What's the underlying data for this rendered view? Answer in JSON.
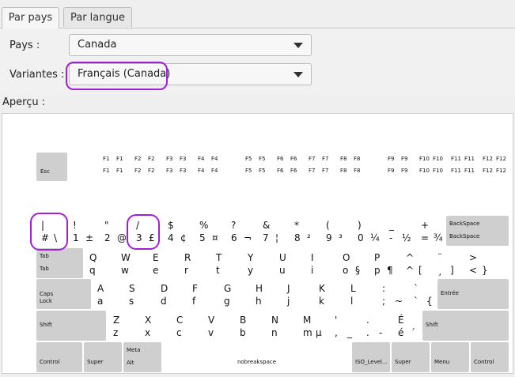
{
  "tabs": [
    {
      "label": "Par pays",
      "active": true
    },
    {
      "label": "Par langue",
      "active": false
    }
  ],
  "country": {
    "label": "Pays :",
    "value": "Canada"
  },
  "variant": {
    "label": "Variantes :",
    "value": "Français (Canada)"
  },
  "preview": {
    "label": "Aperçu :"
  },
  "annotation_color": "#a21fd8",
  "fkeys": {
    "esc": "Esc",
    "groups": [
      [
        "F1",
        "F2",
        "F3",
        "F4"
      ],
      [
        "F5",
        "F6",
        "F7",
        "F8"
      ],
      [
        "F9",
        "F10",
        "F11",
        "F12"
      ]
    ]
  },
  "rows": [
    [
      {
        "tl": "|",
        "bl": "#",
        "br": "\\"
      },
      {
        "tl": "!",
        "bl": "1",
        "br": "±"
      },
      {
        "tl": "\"",
        "bl": "2",
        "br": "@"
      },
      {
        "tl": "/",
        "bl": "3",
        "br": "£"
      },
      {
        "tl": "$",
        "bl": "4",
        "br": "¢"
      },
      {
        "tl": "%",
        "bl": "5",
        "br": "¤"
      },
      {
        "tl": "?",
        "bl": "6",
        "br": "¬"
      },
      {
        "tl": "&",
        "bl": "7",
        "br": "¦"
      },
      {
        "tl": "*",
        "bl": "8",
        "br": "²"
      },
      {
        "tl": "(",
        "bl": "9",
        "br": "³"
      },
      {
        "tl": ")",
        "bl": "0",
        "br": "¼"
      },
      {
        "tl": "_",
        "bl": "-",
        "br": "½"
      },
      {
        "tl": "+",
        "bl": "=",
        "br": "¾"
      },
      {
        "tl": "BackSpace",
        "bl": "BackSpace",
        "br": "",
        "gray": true
      }
    ],
    [
      {
        "tl": "Tab",
        "bl": "Tab",
        "br": "",
        "gray": true
      },
      {
        "tl": "Q",
        "bl": "q",
        "br": ""
      },
      {
        "tl": "W",
        "bl": "w",
        "br": ""
      },
      {
        "tl": "E",
        "bl": "e",
        "br": ""
      },
      {
        "tl": "R",
        "bl": "r",
        "br": ""
      },
      {
        "tl": "T",
        "bl": "t",
        "br": ""
      },
      {
        "tl": "Y",
        "bl": "y",
        "br": ""
      },
      {
        "tl": "U",
        "bl": "u",
        "br": ""
      },
      {
        "tl": "I",
        "bl": "i",
        "br": ""
      },
      {
        "tl": "O",
        "bl": "o",
        "br": "§"
      },
      {
        "tl": "P",
        "bl": "p",
        "br": "¶"
      },
      {
        "tl": "^",
        "bl": "^",
        "br": "["
      },
      {
        "tl": "¨",
        "bl": "¸",
        "br": "]"
      },
      {
        "tl": ">",
        "bl": "<",
        "br": "}"
      }
    ],
    [
      {
        "tl": "Caps\nLock",
        "bl": "",
        "br": "",
        "gray": true
      },
      {
        "tl": "A",
        "bl": "a",
        "br": ""
      },
      {
        "tl": "S",
        "bl": "s",
        "br": ""
      },
      {
        "tl": "D",
        "bl": "d",
        "br": ""
      },
      {
        "tl": "F",
        "bl": "f",
        "br": ""
      },
      {
        "tl": "G",
        "bl": "g",
        "br": ""
      },
      {
        "tl": "H",
        "bl": "h",
        "br": ""
      },
      {
        "tl": "J",
        "bl": "j",
        "br": ""
      },
      {
        "tl": "K",
        "bl": "k",
        "br": ""
      },
      {
        "tl": "L",
        "bl": "l",
        "br": ""
      },
      {
        "tl": ":",
        "bl": ";",
        "br": "~"
      },
      {
        "tl": "`",
        "bl": "`",
        "br": "{"
      },
      {
        "tl": "Entrée",
        "bl": "",
        "br": "",
        "gray": true
      }
    ],
    [
      {
        "tl": "Shift",
        "bl": "",
        "br": "",
        "gray": true
      },
      {
        "tl": "Z",
        "bl": "z",
        "br": ""
      },
      {
        "tl": "X",
        "bl": "x",
        "br": ""
      },
      {
        "tl": "C",
        "bl": "c",
        "br": ""
      },
      {
        "tl": "V",
        "bl": "v",
        "br": ""
      },
      {
        "tl": "B",
        "bl": "b",
        "br": ""
      },
      {
        "tl": "N",
        "bl": "n",
        "br": ""
      },
      {
        "tl": "M",
        "bl": "m",
        "br": "µ"
      },
      {
        "tl": "'",
        "bl": ",",
        "br": "_"
      },
      {
        "tl": ".",
        "bl": ".",
        "br": "-"
      },
      {
        "tl": "É",
        "bl": "é",
        "br": "´"
      },
      {
        "tl": "Shift",
        "bl": "",
        "br": "",
        "gray": true
      }
    ],
    [
      {
        "tl": "Control",
        "bl": "",
        "br": "",
        "gray": true
      },
      {
        "tl": "Super",
        "bl": "",
        "br": "",
        "gray": true
      },
      {
        "tl": "Meta",
        "bl": "Alt",
        "br": "",
        "gray": true
      },
      {
        "tl": "nobreakspace",
        "bl": "",
        "br": ""
      },
      {
        "tl": "ISO_Level...",
        "bl": "",
        "br": "",
        "gray": true
      },
      {
        "tl": "Super",
        "bl": "",
        "br": "",
        "gray": true
      },
      {
        "tl": "Menu",
        "bl": "",
        "br": "",
        "gray": true
      },
      {
        "tl": "Control",
        "bl": "",
        "br": "",
        "gray": true
      }
    ]
  ]
}
